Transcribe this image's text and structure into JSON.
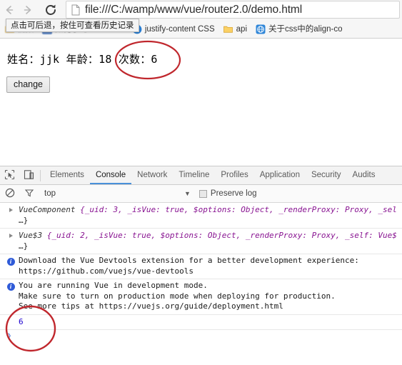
{
  "browser": {
    "nav": {
      "back_icon": "arrow-left-icon",
      "forward_icon": "arrow-right-icon",
      "reload_icon": "reload-icon"
    },
    "url": "file:///C:/wamp/www/vue/router2.0/demo.html",
    "back_tooltip": "点击可后退，按住可查看历史记录",
    "bookmarks": [
      {
        "label": "视频",
        "icon": "folder-icon",
        "blurred": true
      },
      {
        "label": "如何学习css3.0 tra",
        "icon": "blue-square-icon",
        "blurred": true
      },
      {
        "label": "justify-content CSS",
        "icon": "brush-icon",
        "blurred": false
      },
      {
        "label": "api",
        "icon": "folder-icon",
        "blurred": false
      },
      {
        "label": "关于css中的align-co",
        "icon": "globe-icon",
        "blurred": false
      }
    ]
  },
  "page": {
    "content_line": "姓名：jjk 年龄：18 次数：6",
    "button_label": "change"
  },
  "devtools": {
    "inspect_icon": "inspect-element-icon",
    "device_icon": "device-toolbar-icon",
    "tabs": [
      {
        "label": "Elements",
        "active": false
      },
      {
        "label": "Console",
        "active": true
      },
      {
        "label": "Network",
        "active": false
      },
      {
        "label": "Timeline",
        "active": false
      },
      {
        "label": "Profiles",
        "active": false
      },
      {
        "label": "Application",
        "active": false
      },
      {
        "label": "Security",
        "active": false
      },
      {
        "label": "Audits",
        "active": false
      }
    ],
    "filterbar": {
      "clear_icon": "clear-console-icon",
      "filter_icon": "filter-funnel-icon",
      "context": "top",
      "caret_icon": "chevron-down-icon",
      "preserve_log": "Preserve log",
      "preserve_log_checked": false
    },
    "console": {
      "entries": [
        {
          "type": "object",
          "expand_icon": "disclosure-triangle-icon",
          "name": "VueComponent",
          "body": " {_uid: 3, _isVue: true, $options: Object, _renderProxy: Proxy, _sel",
          "second_line": "…}"
        },
        {
          "type": "object",
          "expand_icon": "disclosure-triangle-icon",
          "name": "Vue$3",
          "body": " {_uid: 2, _isVue: true, $options: Object, _renderProxy: Proxy, _self: Vue$",
          "second_line": "…}"
        },
        {
          "type": "info",
          "icon": "info-icon",
          "lines": [
            "Download the Vue Devtools extension for a better development experience:",
            "https://github.com/vuejs/vue-devtools"
          ]
        },
        {
          "type": "info",
          "icon": "info-icon",
          "lines": [
            "You are running Vue in development mode.",
            "Make sure to turn on production mode when deploying for production.",
            "See more tips at https://vuejs.org/guide/deployment.html"
          ]
        },
        {
          "type": "result",
          "value": "6"
        }
      ],
      "prompt_icon": "prompt-chevron-icon"
    }
  },
  "annotations": {
    "color": "#c0272d",
    "ellipse_page_target": "次数：6",
    "ellipse_console_target": "6"
  }
}
